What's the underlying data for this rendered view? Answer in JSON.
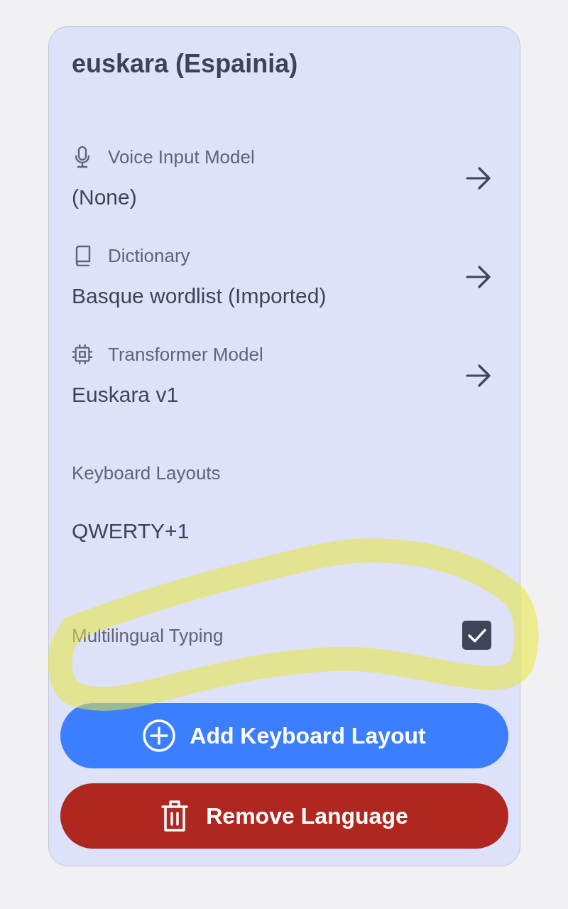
{
  "title": "euskara (Espainia)",
  "settings": [
    {
      "kind": "voice",
      "label": "Voice Input Model",
      "value": "(None)"
    },
    {
      "kind": "dictionary",
      "label": "Dictionary",
      "value": "Basque wordlist (Imported)"
    },
    {
      "kind": "model",
      "label": "Transformer Model",
      "value": "Euskara v1"
    }
  ],
  "keyboard_layouts": {
    "label": "Keyboard Layouts",
    "value": "QWERTY+1"
  },
  "multilingual_typing": {
    "label": "Multilingual Typing",
    "checked": true
  },
  "buttons": [
    {
      "kind": "add",
      "label": "Add Keyboard Layout"
    },
    {
      "kind": "remove",
      "label": "Remove Language"
    }
  ],
  "annotations": [
    {
      "kind": "highlight_loop"
    }
  ]
}
